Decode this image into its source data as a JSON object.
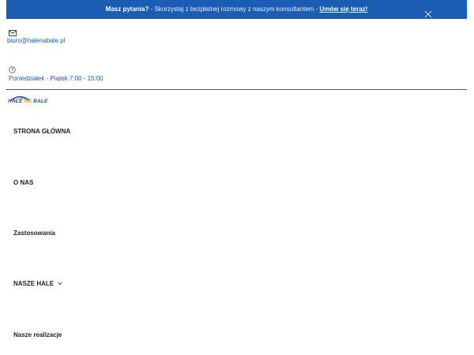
{
  "banner": {
    "question": "Masz pytania?",
    "separator": " - ",
    "message": "Skorzystaj z bezpłatnej rozmowy z naszym konsultantem",
    "cta": "Umów się teraz!"
  },
  "contact": {
    "email": "biuro@halenabale.pl",
    "hours": "Poniedziałek - Piątek 7:00 - 15:00"
  },
  "logo": {
    "part1": "HALE ",
    "part2": "NA",
    "part3": " BALE"
  },
  "nav": {
    "items": [
      {
        "label": "STRONA GŁÓWNA"
      },
      {
        "label": "O NAS"
      },
      {
        "label": "Zastosowania"
      },
      {
        "label": "NASZE HALE"
      },
      {
        "label": "Nasze realizacje"
      }
    ]
  },
  "colors": {
    "banner_bg": "#1a5db3",
    "link": "#1e5ab5",
    "logo_blue": "#1a4fa8",
    "logo_orange": "#e39b1a"
  }
}
